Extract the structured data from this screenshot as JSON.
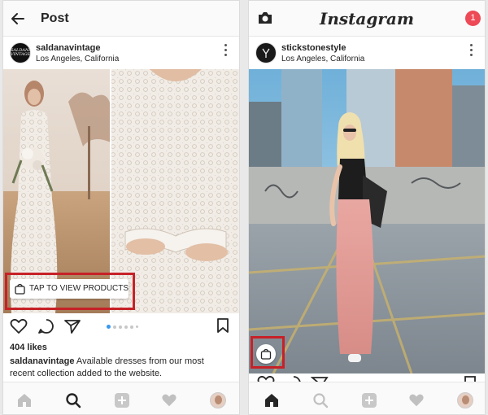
{
  "left_screen": {
    "header": {
      "title": "Post"
    },
    "post": {
      "avatar_text": "SALDANA VINTAGE",
      "username": "saldanavintage",
      "location": "Los Angeles, California",
      "tag_button_label": "TAP TO VIEW PRODUCTS",
      "likes": "404 likes",
      "caption_user": "saldanavintage",
      "caption_text": " Available dresses from our most recent collection added to the website."
    }
  },
  "right_screen": {
    "header": {
      "logo": "Instagram",
      "notification_count": "1"
    },
    "post": {
      "username": "stickstonestyle",
      "location": "Los Angeles, California"
    }
  },
  "colors": {
    "highlight": "#c62127",
    "notification": "#ed4956",
    "carousel_active": "#3897f0"
  }
}
